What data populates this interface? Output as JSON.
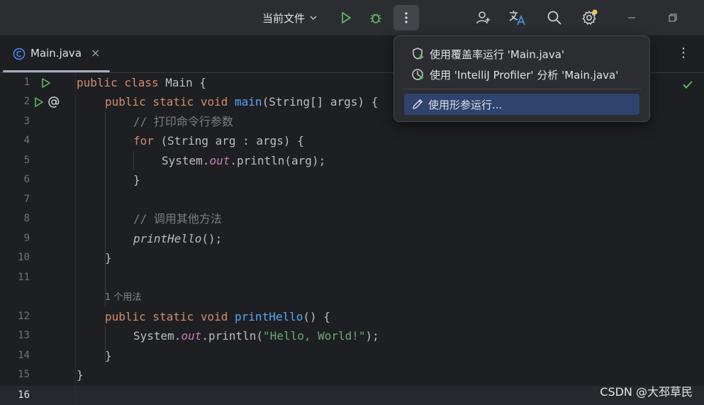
{
  "toolbar": {
    "run_config_label": "当前文件",
    "icons": [
      "run-icon",
      "debug-icon",
      "more-vertical-icon",
      "add-user-icon",
      "translate-icon",
      "search-icon",
      "settings-icon",
      "minimize-icon",
      "restore-icon"
    ]
  },
  "tabs": [
    {
      "label": "Main.java",
      "icon": "class-c-icon",
      "close": "×"
    }
  ],
  "tab_menu_glyph": "⋮",
  "editor": {
    "line_numbers": [
      "1",
      "2",
      "3",
      "4",
      "5",
      "6",
      "7",
      "8",
      "9",
      "10",
      "11",
      "12",
      "13",
      "14",
      "15",
      "16"
    ],
    "usage_hint": "1 个用法",
    "code": {
      "l1_kw": "public class ",
      "l1_name": "Main {",
      "l2_kw": "public static void ",
      "l2_fn": "main",
      "l2_rest": "(String[] args) {",
      "l3_cm": "// 打印命令行参数",
      "l4_kw": "for",
      "l4_rest": " (String arg : args) {",
      "l5_a": "System.",
      "l5_out": "out",
      "l5_b": ".println(arg);",
      "l6": "}",
      "l8_cm": "// 调用其他方法",
      "l9_it": "printHello",
      "l9_rest": "();",
      "l10": "}",
      "l12_kw": "public static void ",
      "l12_fn": "printHello",
      "l12_rest": "() {",
      "l13_a": "System.",
      "l13_out": "out",
      "l13_b": ".println(",
      "l13_str": "\"Hello, World!\"",
      "l13_c": ");",
      "l14": "}",
      "l15": "}"
    }
  },
  "popup_menu": {
    "items": [
      {
        "label": "使用覆盖率运行 'Main.java'",
        "icon": "coverage-icon"
      },
      {
        "label": "使用 'IntelliJ Profiler' 分析  'Main.java'",
        "icon": "profiler-icon"
      },
      {
        "label": "使用形参运行...",
        "icon": "pencil-icon",
        "selected": true
      }
    ]
  },
  "watermark": "CSDN @大邳草民",
  "colors": {
    "background": "#1e1f22",
    "toolbar": "#2b2d30",
    "run_green": "#5fb865",
    "selection": "#2e436e",
    "keyword": "#cf8e6d",
    "function": "#56a8f5",
    "string": "#6aab73"
  }
}
